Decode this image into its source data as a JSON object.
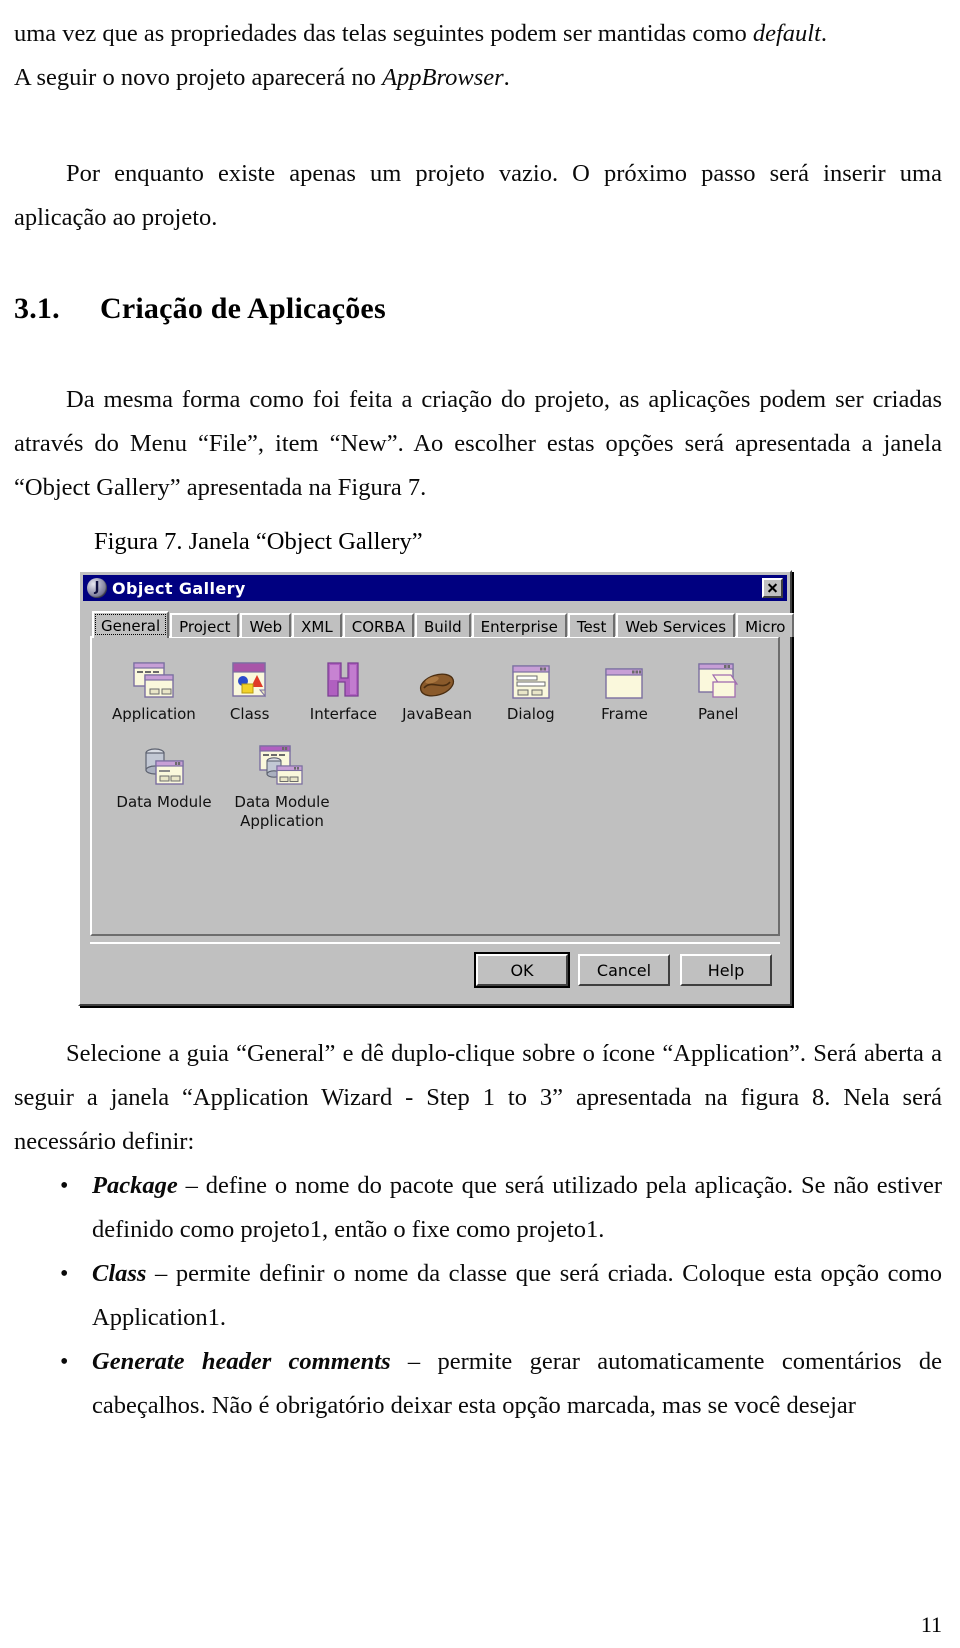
{
  "page": {
    "number": "11"
  },
  "paragraphs": {
    "p1": "uma vez que as propriedades das telas seguintes podem ser mantidas como ",
    "p1_italic": "default",
    "p1_end": ".",
    "p2_start": "A seguir o novo projeto aparecerá no ",
    "p2_italic": "AppBrowser",
    "p2_end": ".",
    "p3": "Por enquanto existe apenas um projeto vazio. O próximo passo será inserir uma aplicação ao projeto.",
    "p4": "Da mesma forma como foi feita a criação do projeto, as aplicações podem ser criadas através do Menu “File”, item “New”. Ao escolher estas opções será apresentada a janela “Object Gallery” apresentada na Figura 7.",
    "p5": "Selecione a guia “General” e dê duplo-clique sobre o ícone “Application”. Será aberta a seguir a janela “Application Wizard - Step 1 to 3” apresentada na figura 8. Nela será necessário definir:"
  },
  "heading": {
    "number": "3.1.",
    "title": "Criação de Aplicações"
  },
  "figure": {
    "caption": "Figura 7. Janela “Object Gallery”"
  },
  "dialog": {
    "title": "Object Gallery",
    "titlebar_icon": "jbuilder-globe-icon",
    "close_label": "×",
    "tabs": [
      {
        "label": "General",
        "selected": true
      },
      {
        "label": "Project",
        "selected": false
      },
      {
        "label": "Web",
        "selected": false
      },
      {
        "label": "XML",
        "selected": false
      },
      {
        "label": "CORBA",
        "selected": false
      },
      {
        "label": "Build",
        "selected": false
      },
      {
        "label": "Enterprise",
        "selected": false
      },
      {
        "label": "Test",
        "selected": false
      },
      {
        "label": "Web Services",
        "selected": false
      },
      {
        "label": "Micro",
        "selected": false
      }
    ],
    "items_row1": [
      {
        "label": "Application",
        "icon": "application-window-icon"
      },
      {
        "label": "Class",
        "icon": "class-shapes-icon"
      },
      {
        "label": "Interface",
        "icon": "interface-blocks-icon"
      },
      {
        "label": "JavaBean",
        "icon": "coffee-bean-icon"
      },
      {
        "label": "Dialog",
        "icon": "dialog-window-icon"
      },
      {
        "label": "Frame",
        "icon": "frame-window-icon"
      },
      {
        "label": "Panel",
        "icon": "panel-window-icon"
      }
    ],
    "items_row2": [
      {
        "label": "Data Module",
        "icon": "data-module-icon"
      },
      {
        "label": "Data Module\nApplication",
        "icon": "data-module-application-icon"
      }
    ],
    "buttons": [
      {
        "label": "OK",
        "default": true
      },
      {
        "label": "Cancel",
        "default": false
      },
      {
        "label": "Help",
        "default": false
      }
    ],
    "colors": {
      "titlebar": "#000080",
      "face": "#c0c0c0",
      "shadow": "#3f3f3f",
      "highlight": "#ffffff",
      "icon_accent": "#b07cc0",
      "icon_paper": "#faf8dc"
    }
  },
  "bullets": [
    {
      "term": "Package",
      "dash": " – ",
      "text": "define o nome do pacote que será utilizado pela aplicação. Se não estiver definido como projeto1, então o fixe como projeto1."
    },
    {
      "term": "Class",
      "dash": " – ",
      "text": "permite definir o nome da classe que será criada. Coloque esta opção como Application1."
    },
    {
      "term": "Generate header comments",
      "dash": " – ",
      "text": "permite gerar automaticamente comentários de cabeçalhos. Não é obrigatório deixar esta opção marcada, mas se você desejar"
    }
  ]
}
